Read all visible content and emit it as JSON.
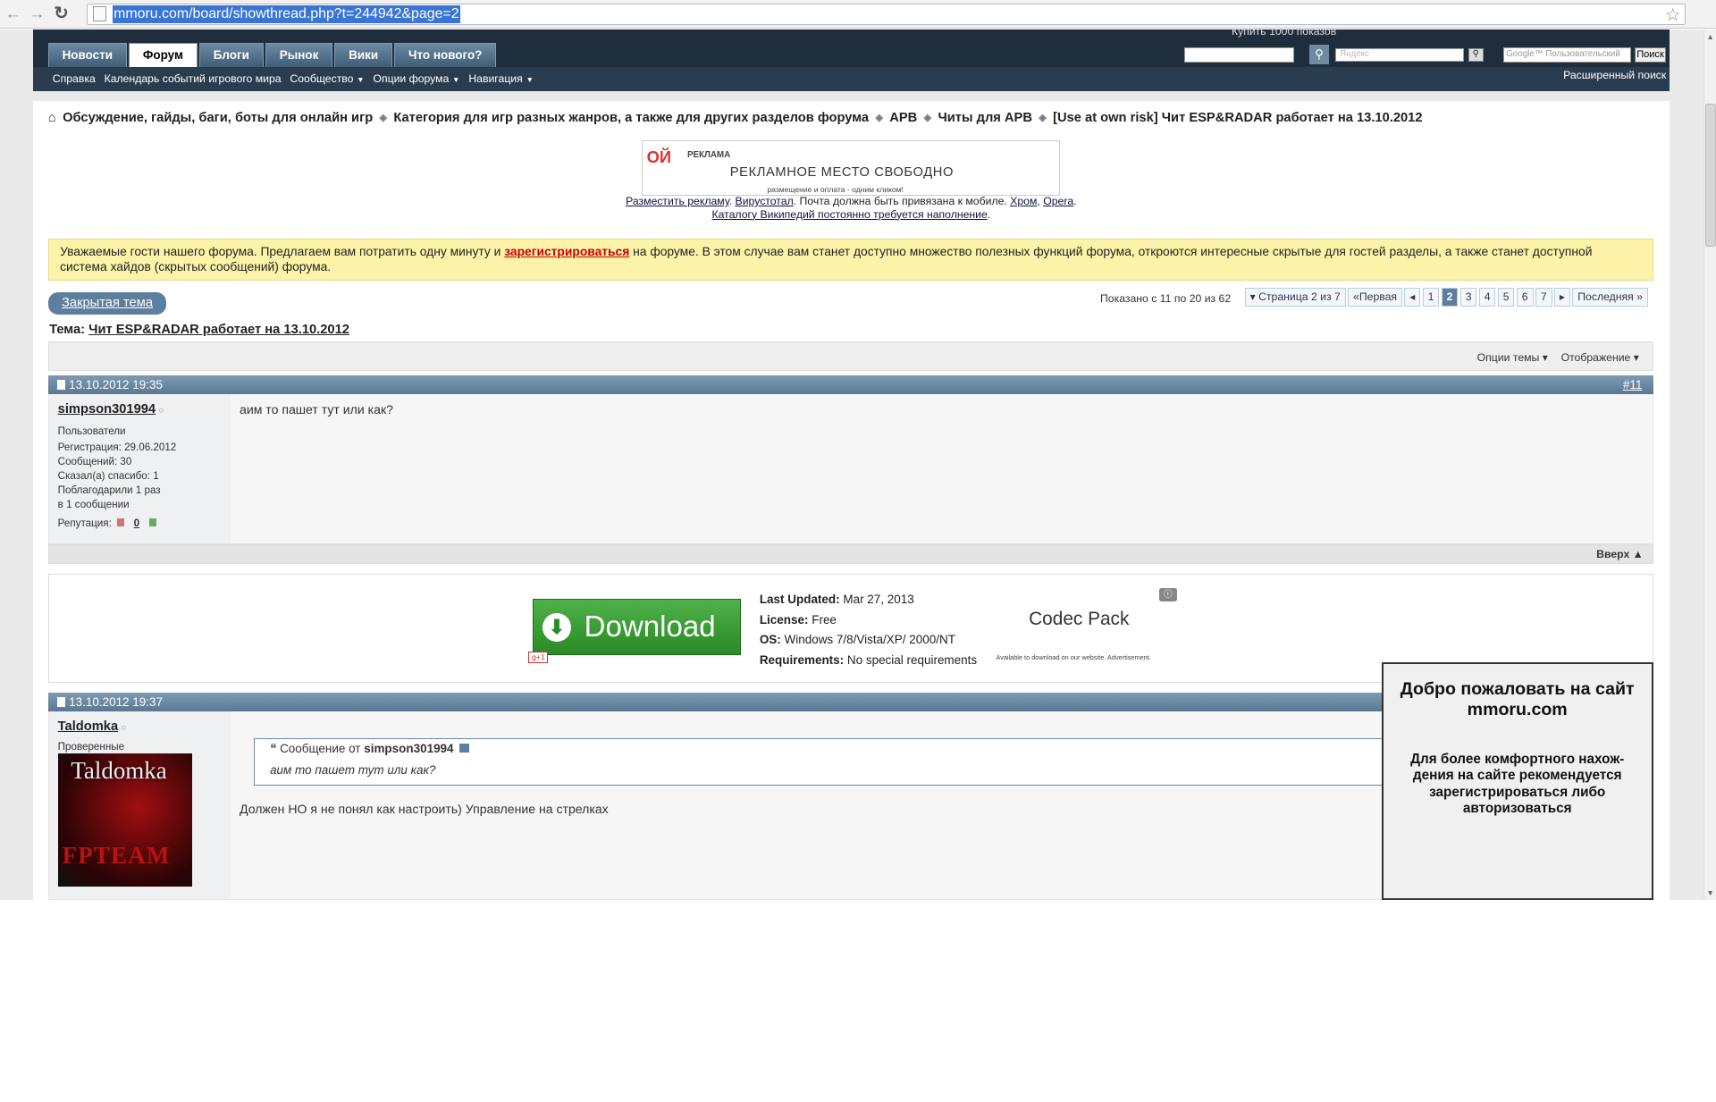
{
  "browser": {
    "url": "mmoru.com/board/showthread.php?t=244942&page=2"
  },
  "header": {
    "promo": "Купить 1000 показов",
    "tabs": [
      "Новости",
      "Форум",
      "Блоги",
      "Рынок",
      "Вики",
      "Что нового?"
    ],
    "active_tab": "Форум",
    "subnav": [
      "Справка",
      "Календарь событий игрового мира",
      "Сообщество",
      "Опции форума",
      "Навигация"
    ],
    "search2_placeholder": "Яндекс",
    "google_placeholder": "Google™ Пользовательский",
    "search_button": "Поиск",
    "advanced_search": "Расширенный поиск"
  },
  "breadcrumb": [
    "Обсуждение, гайды, баги, боты для онлайн игр",
    "Категория для игр разных жанров, а также для других разделов форума",
    "APB",
    "Читы для APB",
    "[Use at own risk] Чит ESP&RADAR работает на 13.10.2012"
  ],
  "ad": {
    "logo": "ОЙ",
    "logo_text": "РЕКЛАМА",
    "logo_sub": "одним кликом",
    "main": "РЕКЛАМНОЕ МЕСТО СВОБОДНО",
    "sub": "размещение и оплата - одним кликом!",
    "link1": "Разместить рекламу",
    "link2": "Вирустотал",
    "text_mid": ". Почта должна быть привязана к мобиле. ",
    "link3": "Хром",
    "link4": "Opera",
    "link5": "Каталогу Википедий постоянно требуется наполнение"
  },
  "notice": {
    "before": "Уважаемые гости нашего форума. Предлагаем вам потратить одну минуту и ",
    "link": "зарегистрироваться",
    "after": " на форуме. В этом случае вам станет доступно множество полезных функций форума, откроются интересные скрытые для гостей разделы, а также станет доступной система хайдов (скрытых сообщений) форума."
  },
  "thread": {
    "closed": "Закрытая тема",
    "showing": "Показано с 11 по 20 из 62",
    "pager": [
      "▾ Страница 2 из 7",
      "«Первая",
      "◂",
      "1",
      "2",
      "3",
      "4",
      "5",
      "6",
      "7",
      "▸",
      "Последняя »"
    ],
    "current_page": "2",
    "title_label": "Тема:",
    "title": "Чит ESP&RADAR работает на 13.10.2012",
    "options": "Опции темы ▾",
    "display": "Отображение ▾"
  },
  "post1": {
    "date": "13.10.2012 19:35",
    "num": "#11",
    "user": "simpson301994",
    "group": "Пользователи",
    "reg": "Регистрация:   29.06.2012",
    "msgs": "Сообщений:   30",
    "thanks": "Сказал(а) спасибо:    1",
    "thanked1": "Поблагодарили 1 раз",
    "thanked2": "в 1 сообщении",
    "rep_label": "Репутация:",
    "rep": "0",
    "text": "аим то пашет тут или как?",
    "up": "Вверх ▲"
  },
  "dl": {
    "button": "Download",
    "updated_label": "Last Updated:",
    "updated": " Mar 27, 2013",
    "license_label": "License:",
    "license": " Free",
    "os_label": "OS:",
    "os": " Windows 7/8/Vista/XP/ 2000/NT",
    "req_label": "Requirements:",
    "req": " No special requirements",
    "title": "Codec Pack",
    "avail": "Available to download on our website. Advertisement."
  },
  "post2": {
    "date": "13.10.2012 19:37",
    "user": "Taldomka",
    "group": "Проверенные",
    "avatar1": "Taldomka",
    "avatar2": "FPTEAM",
    "quote_label": "Сообщение от",
    "quote_user": "simpson301994",
    "quote_text": "аим то пашет тут или как?",
    "text": "Должен НО я не понял как настроить) Управление на стрелках"
  },
  "popup": {
    "title": "Добро пожаловать на сайт mmoru.com",
    "body": "Для более комфортного нахож-дения на сайте рекомендуется зарегистрироваться либо авторизоваться"
  }
}
